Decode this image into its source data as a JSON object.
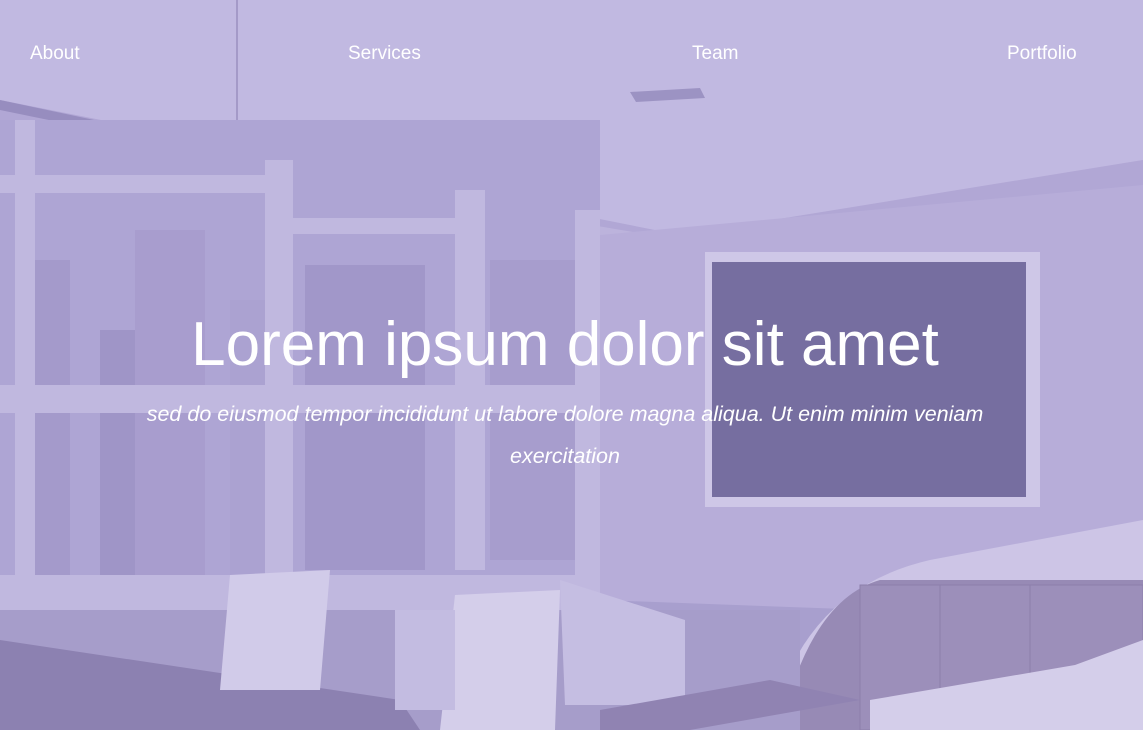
{
  "nav": {
    "items": [
      {
        "label": "About"
      },
      {
        "label": "Services"
      },
      {
        "label": "Team"
      },
      {
        "label": "Portfolio"
      }
    ]
  },
  "hero": {
    "title": "Lorem ipsum dolor sit amet",
    "subtitle": "sed do eiusmod tempor incididunt ut labore dolore magna aliqua. Ut enim minim veniam exercitation"
  },
  "colors": {
    "overlay": "#8c7dc8",
    "text": "#ffffff"
  }
}
